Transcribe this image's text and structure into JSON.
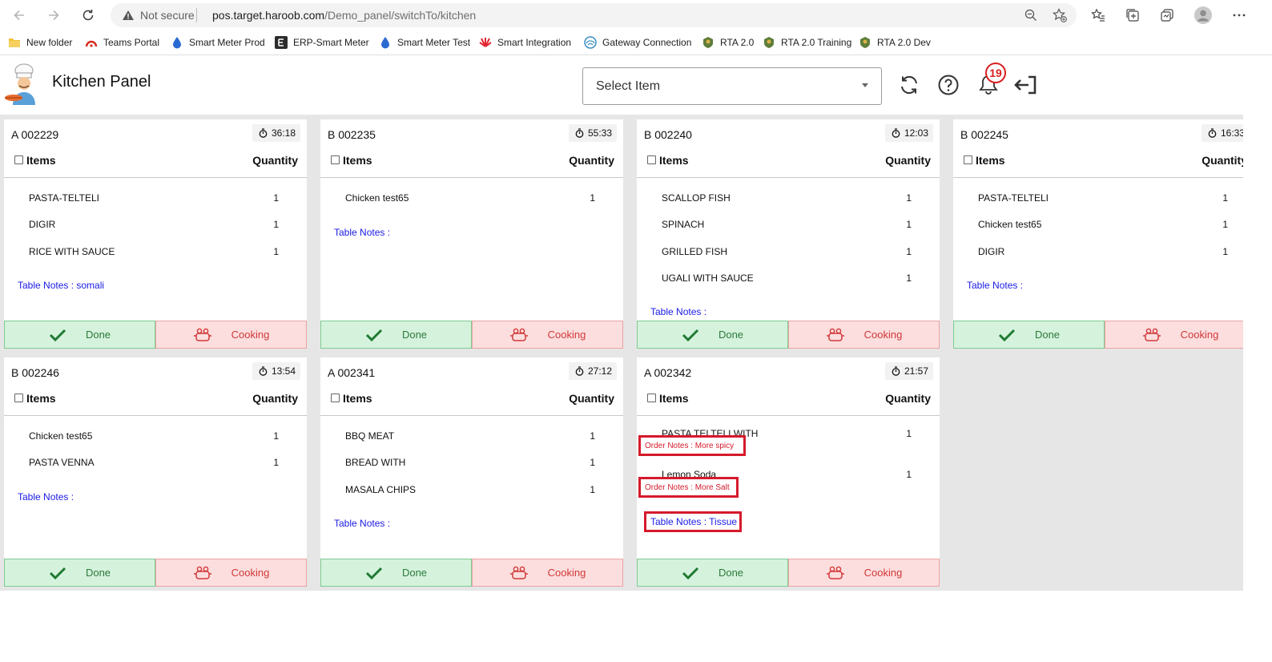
{
  "browser": {
    "security_label": "Not secure",
    "url_host": "pos.target.haroob.com",
    "url_path": "/Demo_panel/switchTo/kitchen"
  },
  "favorites": [
    {
      "label": "New folder",
      "icon": "folder-icon"
    },
    {
      "label": "Teams Portal",
      "icon": "teams-portal-icon"
    },
    {
      "label": "Smart Meter Prod",
      "icon": "water-drop-icon"
    },
    {
      "label": "ERP-Smart Meter",
      "icon": "erp-icon"
    },
    {
      "label": "Smart Meter Test",
      "icon": "water-drop-icon"
    },
    {
      "label": "Smart Integration",
      "icon": "huawei-icon"
    },
    {
      "label": "Gateway Connection",
      "icon": "gateway-icon"
    },
    {
      "label": "RTA 2.0",
      "icon": "rta-emblem-icon"
    },
    {
      "label": "RTA 2.0 Training",
      "icon": "rta-emblem-icon"
    },
    {
      "label": "RTA 2.0 Dev",
      "icon": "rta-emblem-icon"
    }
  ],
  "header": {
    "title": "Kitchen Panel",
    "select_placeholder": "Select Item",
    "notification_count": "19"
  },
  "colors": {
    "done_bg": "#d5f2dc",
    "cooking_bg": "#fcdede",
    "notes_blue": "#1a1ae6",
    "highlight_red": "#d51a2c"
  },
  "labels": {
    "items": "Items",
    "quantity": "Quantity",
    "done": "Done",
    "cooking": "Cooking"
  },
  "orders": [
    {
      "number": "A 002229",
      "timer": "36:18",
      "items": [
        {
          "name": "PASTA-TELTELI",
          "qty": "1"
        },
        {
          "name": "DIGIR",
          "qty": "1"
        },
        {
          "name": "RICE WITH SAUCE",
          "qty": "1"
        }
      ],
      "table_notes": "Table Notes : somali"
    },
    {
      "number": "B 002235",
      "timer": "55:33",
      "items": [
        {
          "name": "Chicken test65",
          "qty": "1"
        }
      ],
      "table_notes": "Table Notes :"
    },
    {
      "number": "B 002240",
      "timer": "12:03",
      "items": [
        {
          "name": "SCALLOP FISH",
          "qty": "1"
        },
        {
          "name": "SPINACH",
          "qty": "1"
        },
        {
          "name": "GRILLED FISH",
          "qty": "1"
        },
        {
          "name": "UGALI WITH SAUCE",
          "qty": "1"
        }
      ],
      "table_notes": "Table Notes :"
    },
    {
      "number": "B 002245",
      "timer": "16:33",
      "items": [
        {
          "name": "PASTA-TELTELI",
          "qty": "1"
        },
        {
          "name": "Chicken test65",
          "qty": "1"
        },
        {
          "name": "DIGIR",
          "qty": "1"
        }
      ],
      "table_notes": "Table Notes :"
    },
    {
      "number": "B 002246",
      "timer": "13:54",
      "items": [
        {
          "name": "Chicken test65",
          "qty": "1"
        },
        {
          "name": "PASTA VENNA",
          "qty": "1"
        }
      ],
      "table_notes": "Table Notes :"
    },
    {
      "number": "A 002341",
      "timer": "27:12",
      "items": [
        {
          "name": "BBQ MEAT",
          "qty": "1"
        },
        {
          "name": "BREAD WITH",
          "qty": "1"
        },
        {
          "name": "MASALA CHIPS",
          "qty": "1"
        }
      ],
      "table_notes": "Table Notes :"
    },
    {
      "number": "A 002342",
      "timer": "21:57",
      "items": [
        {
          "name": "PASTA TELTELI WITH",
          "qty": "1",
          "order_notes": "Order Notes : More spicy"
        },
        {
          "name": "Lemon Soda",
          "qty": "1",
          "order_notes": "Order Notes : More Salt"
        }
      ],
      "table_notes": "Table Notes : Tissue"
    }
  ]
}
